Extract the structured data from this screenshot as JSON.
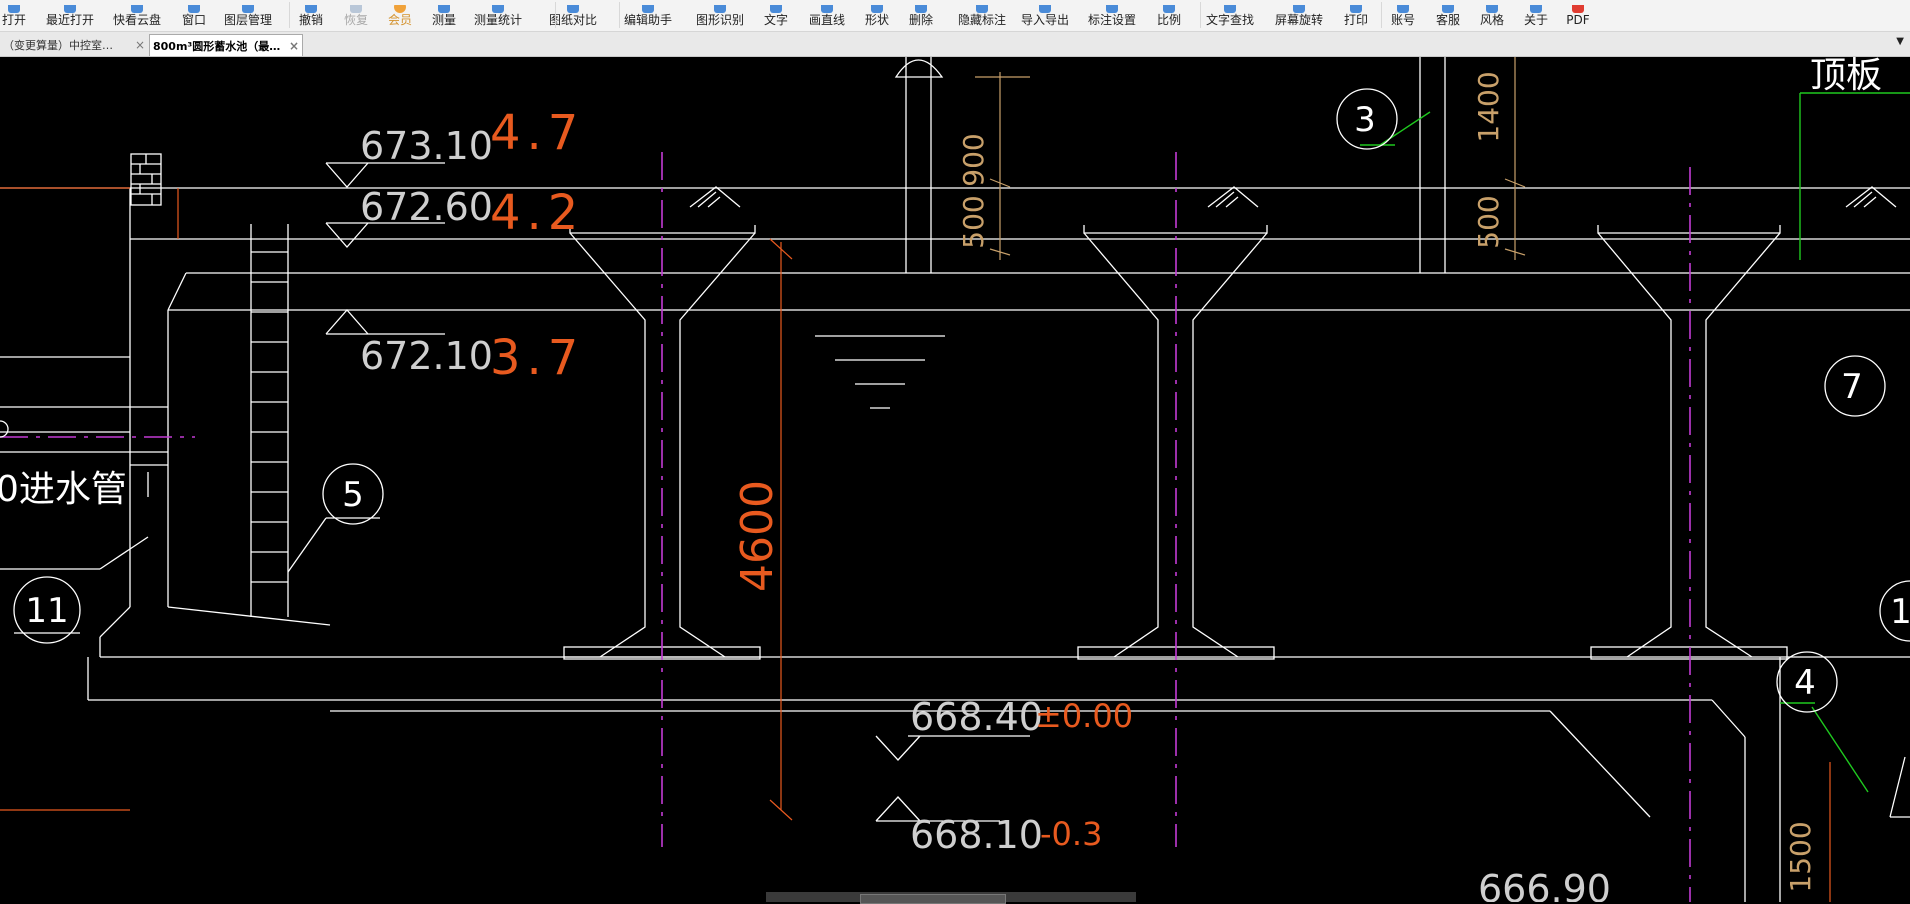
{
  "toolbar": {
    "items": [
      {
        "label": "打开",
        "icon": "open-icon"
      },
      {
        "label": "最近打开",
        "icon": "recent-icon"
      },
      {
        "label": "快看云盘",
        "icon": "cloud-icon"
      },
      {
        "label": "窗口",
        "icon": "window-icon"
      },
      {
        "label": "图层管理",
        "icon": "layers-icon"
      },
      {
        "label": "撤销",
        "icon": "undo-icon"
      },
      {
        "label": "恢复",
        "icon": "redo-icon"
      },
      {
        "label": "会员",
        "icon": "vip-icon"
      },
      {
        "label": "测量",
        "icon": "ruler-icon"
      },
      {
        "label": "测量统计",
        "icon": "stats-icon"
      },
      {
        "label": "图纸对比",
        "icon": "compare-icon"
      },
      {
        "label": "编辑助手",
        "icon": "edit-icon"
      },
      {
        "label": "图形识别",
        "icon": "recognize-icon"
      },
      {
        "label": "文字",
        "icon": "text-icon"
      },
      {
        "label": "画直线",
        "icon": "line-icon"
      },
      {
        "label": "形状",
        "icon": "shape-icon"
      },
      {
        "label": "删除",
        "icon": "delete-icon"
      },
      {
        "label": "隐藏标注",
        "icon": "hide-annotation-icon"
      },
      {
        "label": "导入导出",
        "icon": "import-export-icon"
      },
      {
        "label": "标注设置",
        "icon": "annotation-settings-icon"
      },
      {
        "label": "比例",
        "icon": "scale-icon"
      },
      {
        "label": "文字查找",
        "icon": "text-search-icon"
      },
      {
        "label": "屏幕旋转",
        "icon": "rotate-icon"
      },
      {
        "label": "打印",
        "icon": "print-icon"
      },
      {
        "label": "账号",
        "icon": "account-icon"
      },
      {
        "label": "客服",
        "icon": "support-icon"
      },
      {
        "label": "风格",
        "icon": "style-icon"
      },
      {
        "label": "关于",
        "icon": "about-icon"
      },
      {
        "label": "PDF",
        "icon": "pdf-icon"
      }
    ]
  },
  "tabs": [
    {
      "label": "（变更算量）中控室…",
      "close": "×",
      "active": false
    },
    {
      "label": "800m³圆形蓄水池（最…",
      "close": "×",
      "active": true
    }
  ],
  "tab_dropdown": "▼",
  "drawing": {
    "elevations": [
      {
        "value": "673.10",
        "rel": "4.7"
      },
      {
        "value": "672.60",
        "rel": "4.2"
      },
      {
        "value": "672.10",
        "rel": "3.7"
      },
      {
        "value": "668.40",
        "rel": "±0.00"
      },
      {
        "value": "668.10",
        "rel": "-0.3"
      },
      {
        "value": "666.90"
      }
    ],
    "dimensions": {
      "d900": "900",
      "d500a": "500",
      "d1400": "1400",
      "d500b": "500",
      "d4600": "4600",
      "d1500": "1500"
    },
    "callouts": [
      "3",
      "5",
      "7",
      "11",
      "4",
      "1"
    ],
    "labels": {
      "roof_slab": "顶板",
      "inlet_pipe": "0进水管"
    },
    "colors": {
      "background": "#000000",
      "lines": "#ffffff",
      "orange": "#e85a1f",
      "magenta": "#c23bd4",
      "green": "#1fc91f",
      "tan": "#c8a06a",
      "gray": "#cfcfcf"
    }
  }
}
